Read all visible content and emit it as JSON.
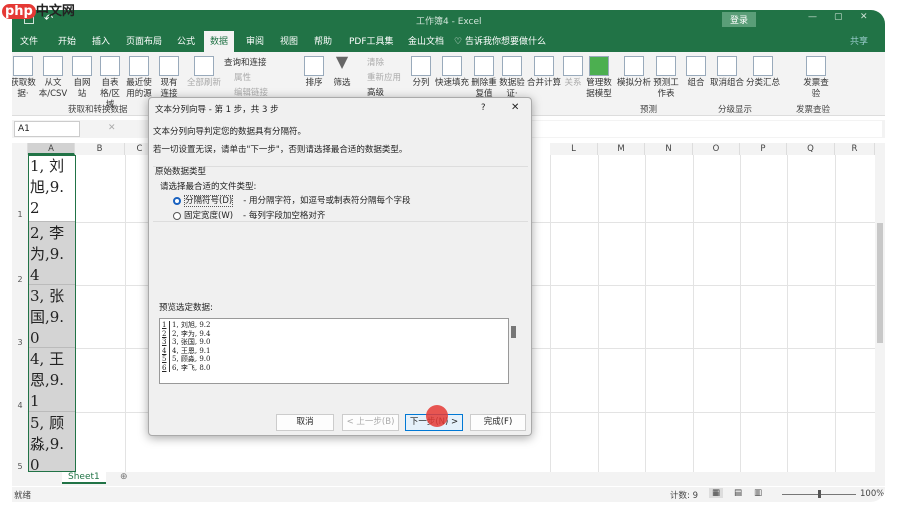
{
  "watermark": "php中文网",
  "titlebar": {
    "title": "工作簿4 - Excel",
    "login": "登录"
  },
  "tabs": [
    "文件",
    "开始",
    "插入",
    "页面布局",
    "公式",
    "数据",
    "审阅",
    "视图",
    "帮助",
    "PDF工具集",
    "金山文档"
  ],
  "active_tab": "数据",
  "tell_me": "告诉我你想要做什么",
  "share": "共享",
  "ribbon": {
    "get_data": "获取数据·",
    "from_csv": "从文本/CSV",
    "from_web": "自网站",
    "from_table": "自表格/区域",
    "recent": "最近使用的源",
    "existing": "现有连接",
    "refresh_all": "全部刷新",
    "queries": "查询和连接",
    "properties": "属性",
    "edit_links": "编辑链接",
    "sort": "排序",
    "filter": "筛选",
    "clear": "清除",
    "reapply": "重新应用",
    "advanced": "高级",
    "text_to_columns": "分列",
    "flash_fill": "快速填充",
    "remove_dup": "删除重复值",
    "data_validation": "数据验证·",
    "consolidate": "合并计算",
    "relations": "关系",
    "data_model": "管理数据模型",
    "what_if": "模拟分析",
    "forecast": "预测工作表",
    "group": "组合",
    "ungroup": "取消组合",
    "subtotal": "分类汇总",
    "invoice": "发票查验",
    "groups": [
      "获取和转换数据",
      "预测",
      "分级显示",
      "发票查验"
    ]
  },
  "namebox": "A1",
  "columns": [
    "A",
    "B",
    "C",
    "L",
    "M",
    "N",
    "O",
    "P",
    "Q",
    "R"
  ],
  "rows": [
    {
      "n": "1",
      "a": "1, 刘旭,9.2"
    },
    {
      "n": "2",
      "a": "2, 李为,9.4"
    },
    {
      "n": "3",
      "a": "3, 张国,9.0"
    },
    {
      "n": "4",
      "a": "4, 王恩,9.1"
    },
    {
      "n": "5",
      "a": "5, 顾淼,9.0"
    }
  ],
  "sheet_tab": "Sheet1",
  "status": {
    "mode": "就绪",
    "count": "计数: 9",
    "zoom": "100%",
    "zoom_fraction": 0.5
  },
  "dialog": {
    "title": "文本分列向导 - 第 1 步，共 3 步",
    "help": "?",
    "close": "✕",
    "line1": "文本分列向导判定您的数据具有分隔符。",
    "line2": "若一切设置无误，请单击\"下一步\"，否则请选择最合适的数据类型。",
    "group_label": "原始数据类型",
    "choose": "请选择最合适的文件类型:",
    "opt1": "分隔符号(D)",
    "opt1_desc": "- 用分隔字符，如逗号或制表符分隔每个字段",
    "opt2": "固定宽度(W)",
    "opt2_desc": "- 每列字段加空格对齐",
    "selected": "分隔符号(D)",
    "preview_label": "预览选定数据:",
    "preview": [
      {
        "n": "1",
        "t": "1, 刘旭, 9.2"
      },
      {
        "n": "2",
        "t": "2, 李为, 9.4"
      },
      {
        "n": "3",
        "t": "3, 张国, 9.0"
      },
      {
        "n": "4",
        "t": "4, 王恩, 9.1"
      },
      {
        "n": "5",
        "t": "5, 顾淼, 9.0"
      },
      {
        "n": "6",
        "t": "6, 李飞, 8.0"
      }
    ],
    "cancel": "取消",
    "back": "< 上一步(B)",
    "next": "下一步(N) >",
    "finish": "完成(F)"
  },
  "colors": {
    "brand": "#217346",
    "selection": "#d4d4d4",
    "cursor": "#e53935"
  }
}
